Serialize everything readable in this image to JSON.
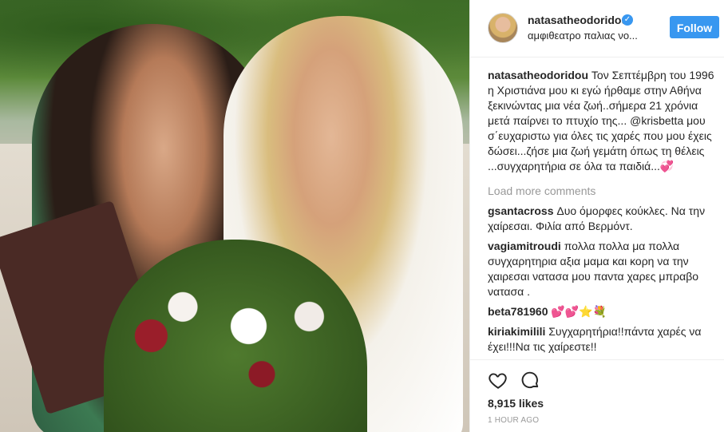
{
  "post": {
    "username": "natasatheodoridou",
    "location": "αμφιθεατρο παλιας νο...",
    "follow_label": "Follow",
    "caption_user": "natasatheodoridou",
    "caption_text": "Τον Σεπτέμβρη του 1996 η Χριστιάνα μου κι εγώ ήρθαμε στην Αθήνα ξεκινώντας μια νέα ζωή..σήμερα 21 χρόνια μετά παίρνει το πτυχίο της... @krisbetta μου σ΄ευχαριστω για όλες τις χαρές που μου έχεις δώσει...ζήσε μια ζωή γεμάτη όπως τη θέλεις ...συγχαρητήρια σε όλα τα παιδιά...",
    "caption_emoji": "💞",
    "load_more": "Load more comments",
    "likes": "8,915 likes",
    "time": "1 HOUR AGO"
  },
  "comments": [
    {
      "user": "gsantacross",
      "text": "Δυο όμορφες κούκλες. Να την χαίρεσαι. Φιλία από Βερμόντ."
    },
    {
      "user": "vagiamitroudi",
      "text": "πολλα πολλα μα πολλα συγχαρητηρια αξια μαμα και κορη να την χαιρεσαι νατασα μου παντα χαρες μπραβο νατασα ."
    },
    {
      "user": "beta781960",
      "text": "💕💕⭐💐"
    },
    {
      "user": "kiriakimilili",
      "text": "Συγχαρητήρια!!πάντα χαρές να έχει!!!Να τις χαίρεστε!!"
    }
  ],
  "icons": {
    "heart": "heart-icon",
    "comment": "comment-icon",
    "verified": "verified-badge-icon"
  },
  "colors": {
    "accent": "#3897f0",
    "muted": "#999999",
    "text": "#262626"
  }
}
